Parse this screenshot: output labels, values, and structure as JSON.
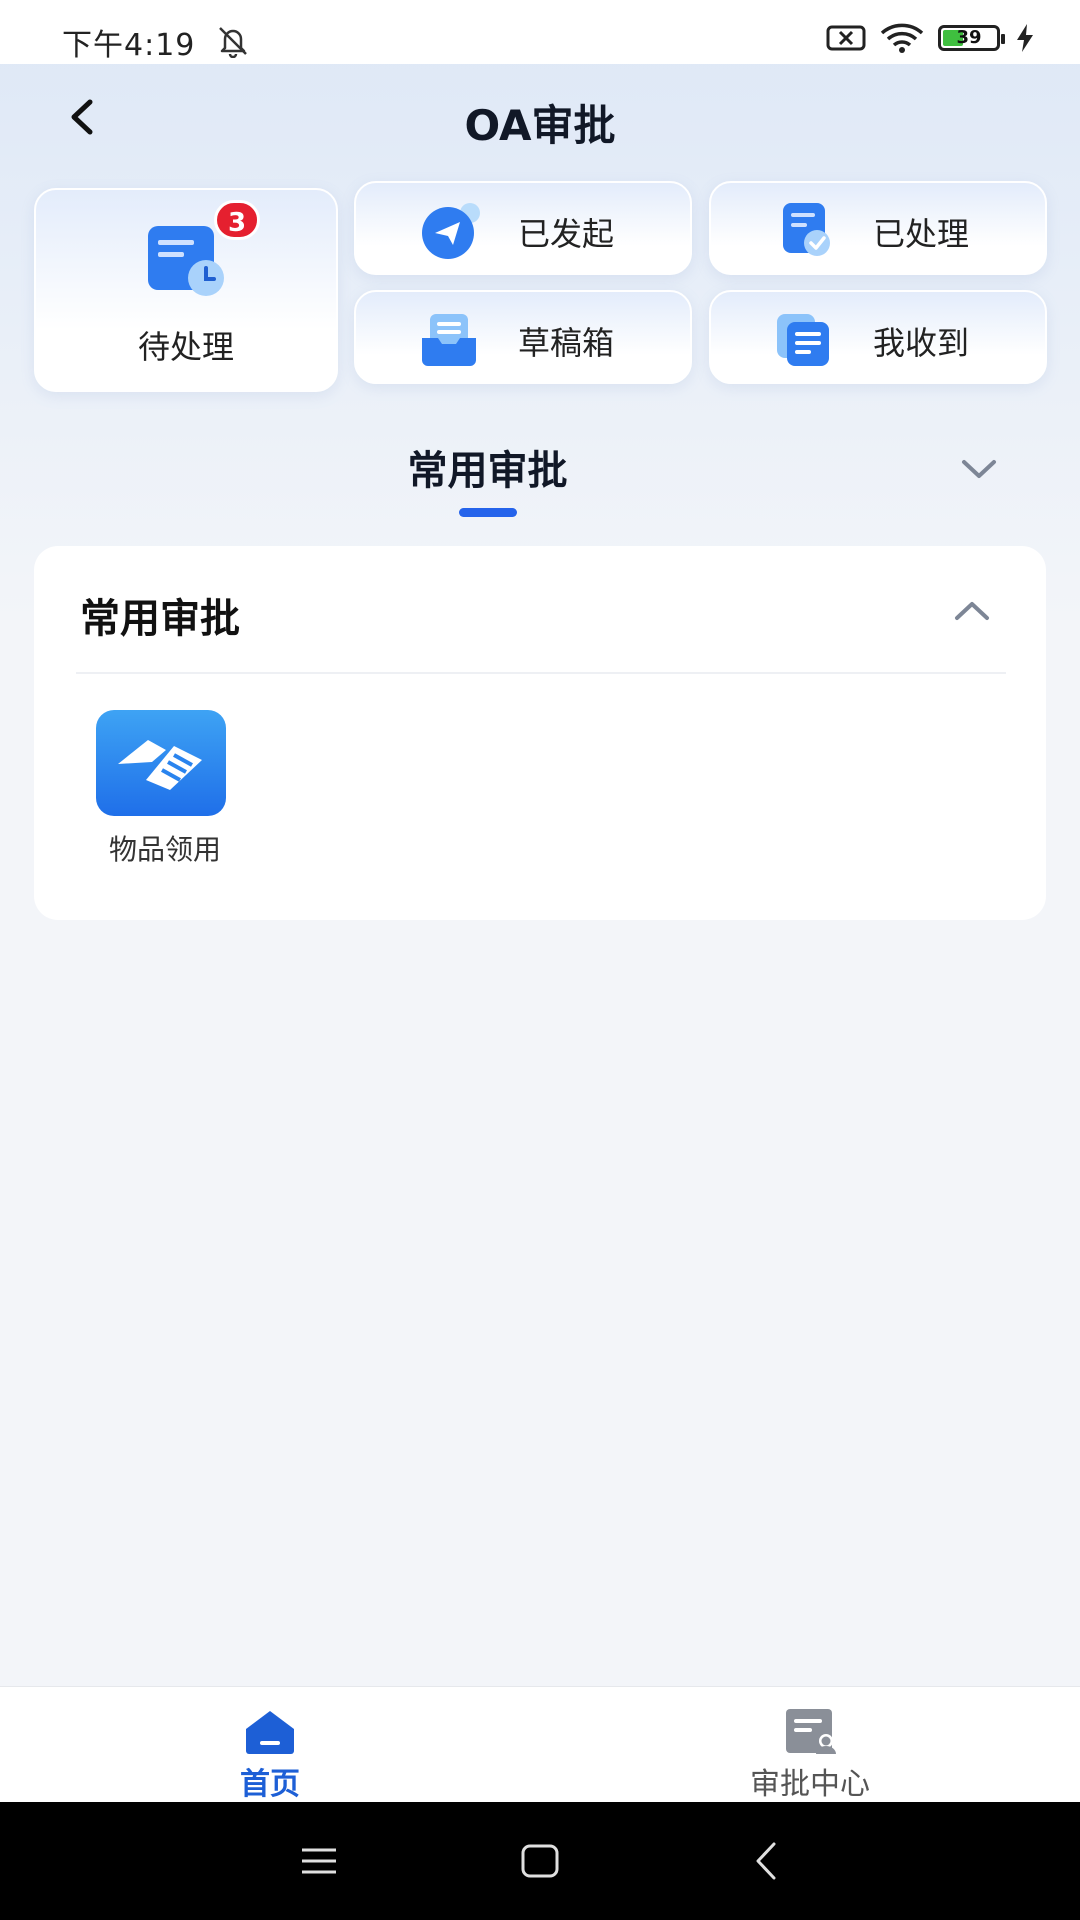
{
  "status_bar": {
    "time": "下午4:19",
    "battery_level": "39",
    "battery_fraction": 0.39,
    "icons": [
      "bell-muted-icon",
      "sim-x-icon",
      "wifi-icon",
      "battery-icon",
      "charging-icon"
    ]
  },
  "header": {
    "title": "OA审批",
    "back_icon": "chevron-left-icon"
  },
  "quick_cards": {
    "pending": {
      "label": "待处理",
      "badge": "3",
      "icon": "pending-doc-icon"
    },
    "initiated": {
      "label": "已发起",
      "icon": "paper-plane-icon"
    },
    "processed": {
      "label": "已处理",
      "icon": "doc-check-icon"
    },
    "drafts": {
      "label": "草稿箱",
      "icon": "drafts-tray-icon"
    },
    "received": {
      "label": "我收到",
      "icon": "doc-received-icon"
    }
  },
  "section_tab": {
    "label": "常用审批",
    "toggle_icon": "chevron-down-icon"
  },
  "panel": {
    "title": "常用审批",
    "collapse_icon": "chevron-up-icon",
    "apps": [
      {
        "label": "物品领用",
        "icon": "handshake-icon"
      }
    ]
  },
  "bottom_nav": {
    "home": {
      "label": "首页",
      "icon": "home-icon",
      "active": true
    },
    "center": {
      "label": "审批中心",
      "icon": "approval-center-icon",
      "active": false
    }
  },
  "system_nav": [
    "menu-icon",
    "home-square-icon",
    "back-icon"
  ],
  "colors": {
    "accent": "#2563eb",
    "badge": "#e5202f",
    "nav_active": "#1d5fd6",
    "app_icon": "#2a84ee"
  }
}
